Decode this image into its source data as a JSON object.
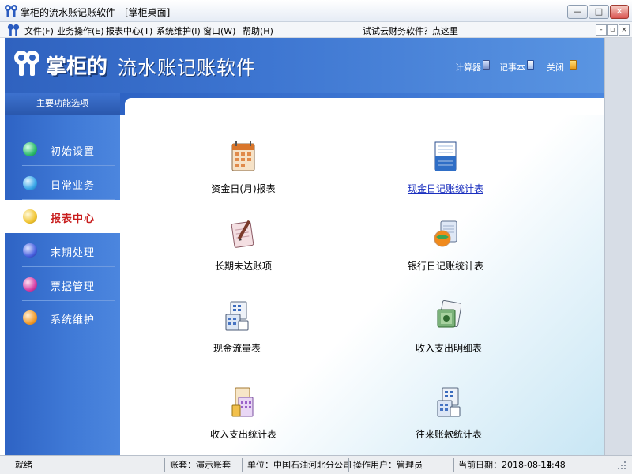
{
  "window": {
    "title": "掌柜的流水账记账软件 - [掌柜桌面]",
    "min_label": "—",
    "max_label": "□",
    "close_label": "✕"
  },
  "menu": {
    "items": [
      "文件(F)",
      "业务操作(E)",
      "报表中心(T)",
      "系统维护(I)",
      "窗口(W)",
      "帮助(H)"
    ],
    "promo": "试试云财务软件？点这里",
    "mdi_buttons": [
      "-",
      "▫",
      "×"
    ]
  },
  "header": {
    "logo_bold": "掌柜的",
    "logo_rest": "流水账记账软件",
    "links": [
      {
        "label": "计算器",
        "icon": "calculator-icon"
      },
      {
        "label": "记事本",
        "icon": "notepad-icon"
      },
      {
        "label": "关闭",
        "icon": "close-icon"
      }
    ]
  },
  "sidebar": {
    "title": "主要功能选项",
    "active_index": 2,
    "items": [
      {
        "label": "初始设置",
        "color": "#2dbb6c"
      },
      {
        "label": "日常业务",
        "color": "#39a6e8"
      },
      {
        "label": "报表中心",
        "color": "#f1c534"
      },
      {
        "label": "末期处理",
        "color": "#4a62e0"
      },
      {
        "label": "票据管理",
        "color": "#d63fa5"
      },
      {
        "label": "系统维护",
        "color": "#f29c2c"
      }
    ]
  },
  "reports": [
    {
      "label": "资金日(月)报表",
      "icon": "calendar-report-icon",
      "link": false
    },
    {
      "label": "现金日记账统计表",
      "icon": "ledger-book-icon",
      "link": true
    },
    {
      "label": "长期未达账项",
      "icon": "notepad-pen-icon",
      "link": false
    },
    {
      "label": "银行日记账统计表",
      "icon": "bank-globe-icon",
      "link": false
    },
    {
      "label": "现金流量表",
      "icon": "spreadsheet-stack-icon",
      "link": false
    },
    {
      "label": "收入支出明细表",
      "icon": "money-detail-icon",
      "link": false
    },
    {
      "label": "收入支出统计表",
      "icon": "document-stats-icon",
      "link": false
    },
    {
      "label": "往来账款统计表",
      "icon": "spreadsheet-stack-icon",
      "link": false
    }
  ],
  "status": {
    "ready": "就绪",
    "account_set": "账套：演示账套",
    "unit": "单位：中国石油河北分公司",
    "operator": "操作用户：管理员",
    "current_date": "当前日期：2018-08-14",
    "time": "11:48"
  },
  "colors": {
    "header_blue": "#2f62bf",
    "sidebar_blue": "#3f79d6",
    "active_text": "#c81d1d",
    "link_blue": "#1a2fbf"
  }
}
